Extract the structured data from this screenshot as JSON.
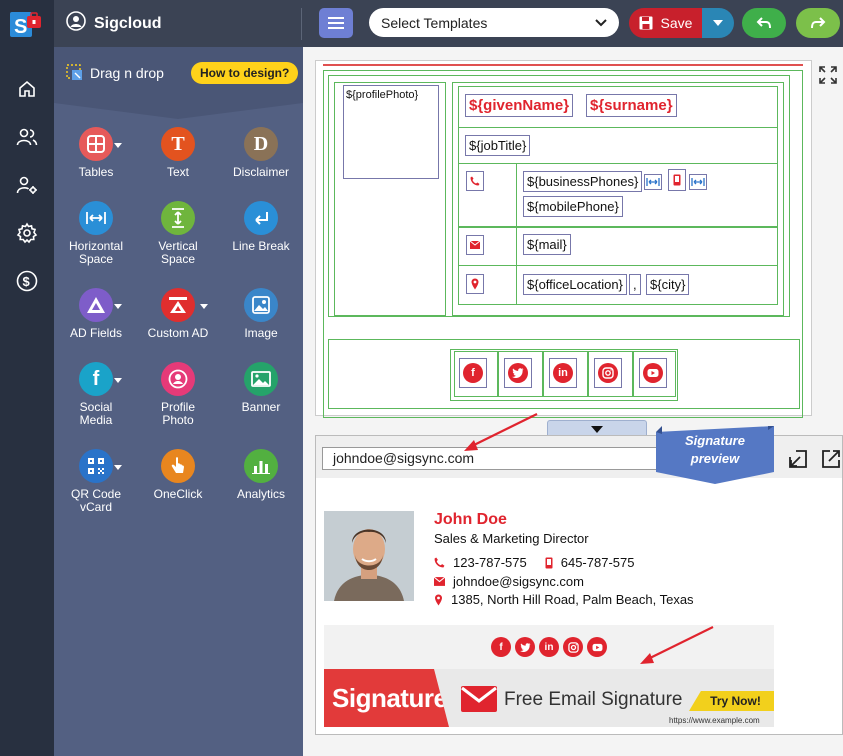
{
  "app": {
    "name": "Sigcloud"
  },
  "toolbar": {
    "template_select": "Select Templates",
    "save_label": "Save"
  },
  "panel": {
    "dnd_title": "Drag n drop",
    "how_to": "How to design?",
    "tools": [
      {
        "label": "Tables",
        "color": "#e65a5a",
        "glyph": "table-icon"
      },
      {
        "label": "Text",
        "color": "#e3531f",
        "glyph": "T"
      },
      {
        "label": "Disclaimer",
        "color": "#8a7257",
        "glyph": "D"
      },
      {
        "label": "Horizontal\nSpace",
        "color": "#2a8fd7"
      },
      {
        "label": "Vertical\nSpace",
        "color": "#6fb53d"
      },
      {
        "label": "Line Break",
        "color": "#2a8fd7"
      },
      {
        "label": "AD Fields",
        "color": "#7e5dc9"
      },
      {
        "label": "Custom AD",
        "color": "#e02e2e"
      },
      {
        "label": "Image",
        "color": "#3a86c9"
      },
      {
        "label": "Social\nMedia",
        "color": "#1aa3c9",
        "glyph": "f"
      },
      {
        "label": "Profile\nPhoto",
        "color": "#e63a78"
      },
      {
        "label": "Banner",
        "color": "#25a36a"
      },
      {
        "label": "QR Code\nvCard",
        "color": "#2a73c9"
      },
      {
        "label": "OneClick",
        "color": "#e8861f"
      },
      {
        "label": "Analytics",
        "color": "#52b040"
      }
    ]
  },
  "canvas": {
    "profile_photo": "${profilePhoto}",
    "given_name": "${givenName}",
    "surname": "${surname}",
    "job_title": "${jobTitle}",
    "business_phones": "${businessPhones}",
    "mobile_phone": "${mobilePhone}",
    "mail": "${mail}",
    "office_location": "${officeLocation}",
    "comma": ",",
    "city": "${city}"
  },
  "preview": {
    "email_value": "johndoe@sigsync.com",
    "ribbon_line1": "Signature",
    "ribbon_line2": "preview",
    "name": "John Doe",
    "title": "Sales & Marketing Director",
    "phone": "123-787-575",
    "mobile": "645-787-575",
    "email": "johndoe@sigsync.com",
    "address": "1385, North Hill Road, Palm Beach, Texas",
    "banner_left": "Signature",
    "banner_mid": "Free Email Signature",
    "banner_try": "Try Now!",
    "banner_url": "https://www.example.com"
  },
  "colors": {
    "accent_red": "#e0242e",
    "rail": "#283040",
    "panel": "#536082"
  }
}
